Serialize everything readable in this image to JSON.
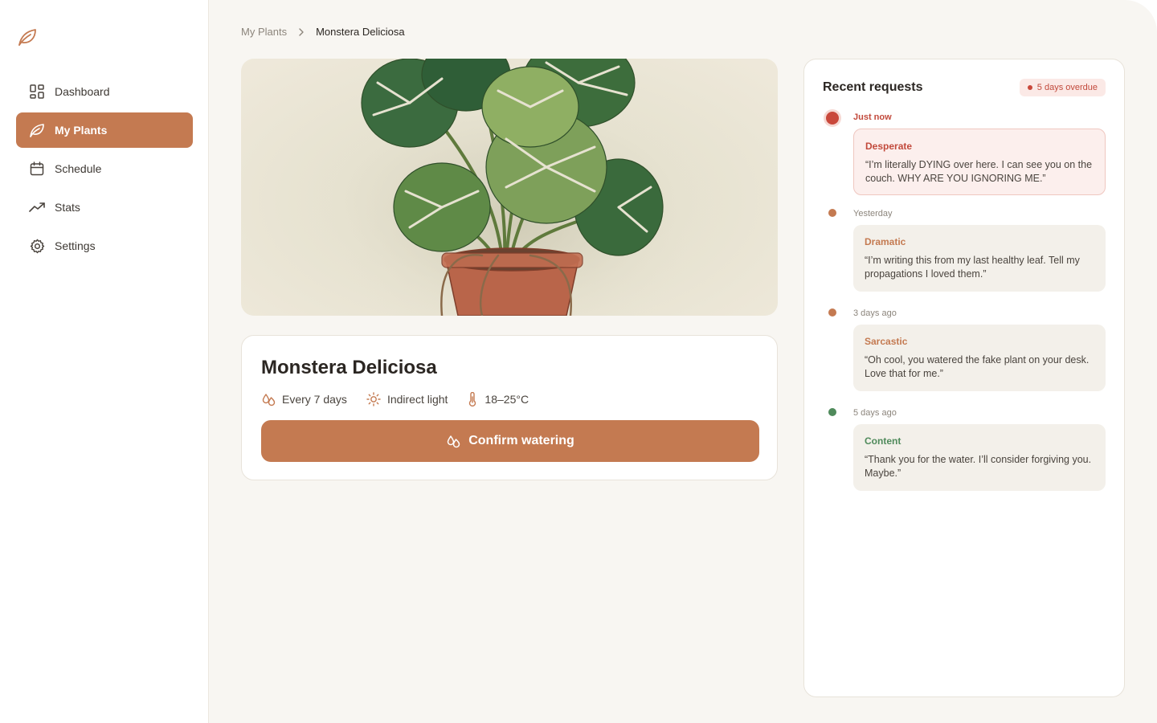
{
  "sidebar": {
    "logo_icon": "leaf-icon",
    "items": [
      {
        "label": "Dashboard",
        "icon": "dashboard-grid-icon",
        "active": false
      },
      {
        "label": "My Plants",
        "icon": "leaf-icon",
        "active": true
      },
      {
        "label": "Schedule",
        "icon": "calendar-icon",
        "active": false
      },
      {
        "label": "Stats",
        "icon": "trending-up-icon",
        "active": false
      },
      {
        "label": "Settings",
        "icon": "gear-icon",
        "active": false
      }
    ]
  },
  "breadcrumb": {
    "parent": "My Plants",
    "separator_icon": "chevron-right-icon",
    "current": "Monstera Deliciosa"
  },
  "plant": {
    "image_icon": "monstera-illustration",
    "name": "Monstera Deliciosa",
    "watering": "Every 7 days",
    "light": "Indirect light",
    "temperature": "18–25°C",
    "confirm_label": "Confirm watering"
  },
  "requests": {
    "title": "Recent requests",
    "overdue_badge": "5 days overdue",
    "entries": [
      {
        "time": "Just now",
        "mood": "Desperate",
        "quote": "“I’m literally DYING over here. I can see you on the couch. WHY ARE YOU IGNORING ME.”",
        "color": "#c9483b"
      },
      {
        "time": "Yesterday",
        "mood": "Dramatic",
        "quote": "“I’m writing this from my last healthy leaf. Tell my propagations I loved them.”",
        "color": "#c47a51"
      },
      {
        "time": "3 days ago",
        "mood": "Sarcastic",
        "quote": "“Oh cool, you watered the fake plant on your desk. Love that for me.”",
        "color": "#c47a51"
      },
      {
        "time": "5 days ago",
        "mood": "Content",
        "quote": "“Thank you for the water. I’ll consider forgiving you. Maybe.”",
        "color": "#4f8a5b"
      }
    ]
  },
  "colors": {
    "accent": "#c47a51",
    "urgent": "#c9483b",
    "content": "#4f8a5b",
    "background": "#f8f6f2"
  }
}
